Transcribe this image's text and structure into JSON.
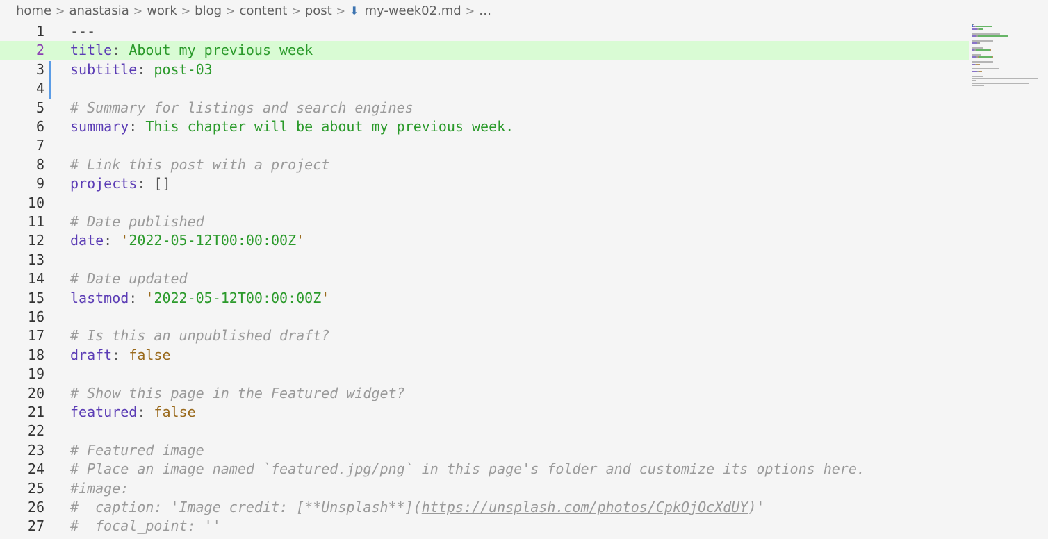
{
  "breadcrumb": {
    "items": [
      "home",
      "anastasia",
      "work",
      "blog",
      "content",
      "post"
    ],
    "file": "my-week02.md",
    "trailing": "…",
    "separator": ">"
  },
  "editor": {
    "current_line": 2,
    "lines": [
      {
        "n": "1",
        "tokens": [
          {
            "t": "---",
            "c": "p"
          }
        ]
      },
      {
        "n": "2",
        "tokens": [
          {
            "t": "title",
            "c": "k"
          },
          {
            "t": ": ",
            "c": "p"
          },
          {
            "t": "About my previous week",
            "c": "s"
          }
        ]
      },
      {
        "n": "3",
        "tokens": [
          {
            "t": "subtitle",
            "c": "k"
          },
          {
            "t": ": ",
            "c": "p"
          },
          {
            "t": "post-03",
            "c": "s"
          }
        ]
      },
      {
        "n": "4",
        "tokens": []
      },
      {
        "n": "5",
        "tokens": [
          {
            "t": "# Summary for listings and search engines",
            "c": "c"
          }
        ]
      },
      {
        "n": "6",
        "tokens": [
          {
            "t": "summary",
            "c": "k"
          },
          {
            "t": ": ",
            "c": "p"
          },
          {
            "t": "This chapter will be about my previous week.",
            "c": "s"
          }
        ]
      },
      {
        "n": "7",
        "tokens": []
      },
      {
        "n": "8",
        "tokens": [
          {
            "t": "# Link this post with a project",
            "c": "c"
          }
        ]
      },
      {
        "n": "9",
        "tokens": [
          {
            "t": "projects",
            "c": "k"
          },
          {
            "t": ": []",
            "c": "p"
          }
        ]
      },
      {
        "n": "10",
        "tokens": []
      },
      {
        "n": "11",
        "tokens": [
          {
            "t": "# Date published",
            "c": "c"
          }
        ]
      },
      {
        "n": "12",
        "tokens": [
          {
            "t": "date",
            "c": "k"
          },
          {
            "t": ": ",
            "c": "p"
          },
          {
            "t": "'",
            "c": "b"
          },
          {
            "t": "2022-05-12T00:00:00Z",
            "c": "s"
          },
          {
            "t": "'",
            "c": "b"
          }
        ]
      },
      {
        "n": "13",
        "tokens": []
      },
      {
        "n": "14",
        "tokens": [
          {
            "t": "# Date updated",
            "c": "c"
          }
        ]
      },
      {
        "n": "15",
        "tokens": [
          {
            "t": "lastmod",
            "c": "k"
          },
          {
            "t": ": ",
            "c": "p"
          },
          {
            "t": "'",
            "c": "b"
          },
          {
            "t": "2022-05-12T00:00:00Z",
            "c": "s"
          },
          {
            "t": "'",
            "c": "b"
          }
        ]
      },
      {
        "n": "16",
        "tokens": []
      },
      {
        "n": "17",
        "tokens": [
          {
            "t": "# Is this an unpublished draft?",
            "c": "c"
          }
        ]
      },
      {
        "n": "18",
        "tokens": [
          {
            "t": "draft",
            "c": "k"
          },
          {
            "t": ": ",
            "c": "p"
          },
          {
            "t": "false",
            "c": "b"
          }
        ]
      },
      {
        "n": "19",
        "tokens": []
      },
      {
        "n": "20",
        "tokens": [
          {
            "t": "# Show this page in the Featured widget?",
            "c": "c"
          }
        ]
      },
      {
        "n": "21",
        "tokens": [
          {
            "t": "featured",
            "c": "k"
          },
          {
            "t": ": ",
            "c": "p"
          },
          {
            "t": "false",
            "c": "b"
          }
        ]
      },
      {
        "n": "22",
        "tokens": []
      },
      {
        "n": "23",
        "tokens": [
          {
            "t": "# Featured image",
            "c": "c"
          }
        ]
      },
      {
        "n": "24",
        "tokens": [
          {
            "t": "# Place an image named `featured.jpg/png` in this page's folder and customize its options here.",
            "c": "c"
          }
        ]
      },
      {
        "n": "25",
        "tokens": [
          {
            "t": "#image:",
            "c": "c"
          }
        ]
      },
      {
        "n": "26",
        "tokens": [
          {
            "t": "#  caption: 'Image credit: [**Unsplash**](",
            "c": "c"
          },
          {
            "t": "https://unsplash.com/photos/CpkOjOcXdUY",
            "c": "c u"
          },
          {
            "t": ")'",
            "c": "c"
          }
        ]
      },
      {
        "n": "27",
        "tokens": [
          {
            "t": "#  focal_point: ''",
            "c": "c"
          }
        ]
      }
    ]
  },
  "colors": {
    "current_line_bg": "#d9fbd4",
    "key": "#5b3cb5",
    "string": "#2b9a2b",
    "comment": "#9a9a9a",
    "boolean": "#9a6a1d",
    "gutter_modified": "#5b9ce6"
  },
  "icons": {
    "file": "markdown-down-arrow-icon"
  }
}
